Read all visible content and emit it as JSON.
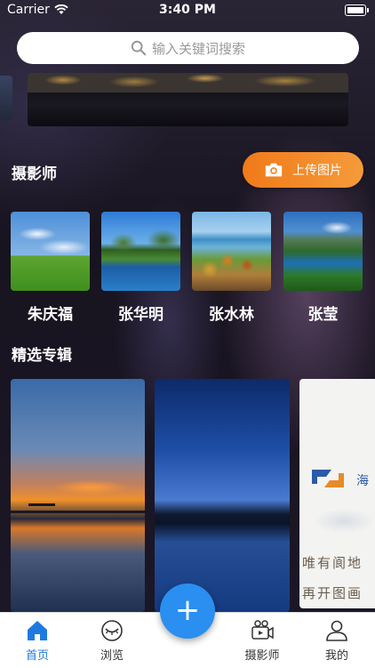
{
  "status_bar": {
    "carrier": "Carrier",
    "time": "3:40 PM"
  },
  "search": {
    "placeholder": "输入关键词搜索"
  },
  "photographers_section": {
    "title": "摄影师",
    "upload_label": "上传图片",
    "items": [
      {
        "name": "朱庆福"
      },
      {
        "name": "张华明"
      },
      {
        "name": "张水林"
      },
      {
        "name": "张莹"
      }
    ]
  },
  "albums_section": {
    "title": "精选专辑",
    "album3_text": {
      "brand": "海",
      "line1": "唯有阆地",
      "line2": "再开图画"
    }
  },
  "tabbar": {
    "fab_label": "+",
    "tabs": [
      {
        "label": "首页",
        "icon": "home-icon",
        "active": true
      },
      {
        "label": "浏览",
        "icon": "eye-closed-icon",
        "active": false
      },
      {
        "label": "摄影师",
        "icon": "video-camera-icon",
        "active": false
      },
      {
        "label": "我的",
        "icon": "user-icon",
        "active": false
      }
    ]
  },
  "colors": {
    "accent": "#1f7ae0",
    "upload": "#f07a1a",
    "fab": "#2a8ff0"
  }
}
